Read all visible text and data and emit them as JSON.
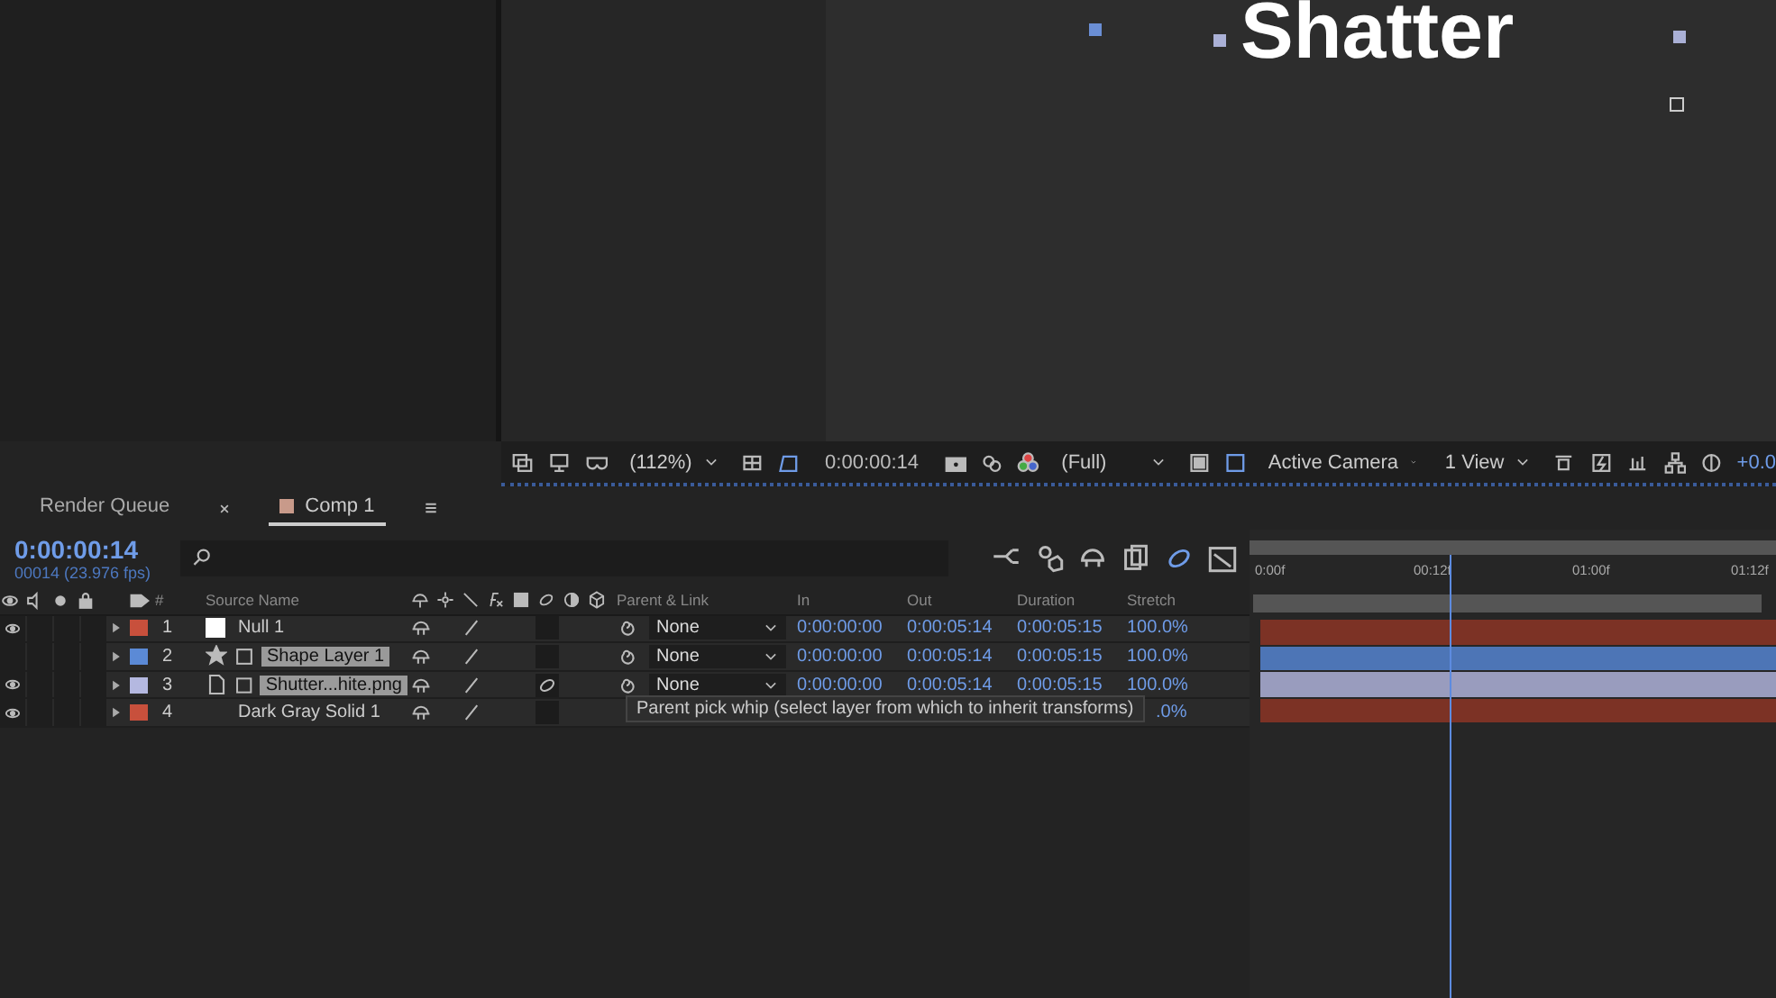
{
  "viewer": {
    "comp_text": "Shatter",
    "zoom": "(112%)",
    "timecode": "0:00:00:14",
    "resolution": "(Full)",
    "camera": "Active Camera",
    "views": "1 View",
    "exposure": "+0.0"
  },
  "tabs": [
    {
      "label": "Render Queue",
      "selected": false
    },
    {
      "label": "Comp 1",
      "selected": true,
      "color": "#c89a8a"
    }
  ],
  "timeline": {
    "current_time": "0:00:00:14",
    "frame_info": "00014 (23.976 fps)",
    "columns": [
      "#",
      "Source Name",
      "Parent & Link",
      "In",
      "Out",
      "Duration",
      "Stretch"
    ],
    "layers": [
      {
        "number": "1",
        "name": "Null 1",
        "kind": "null",
        "color": "#c8503c",
        "visible": true,
        "selected": false,
        "parent": "None",
        "in": "0:00:00:00",
        "out": "0:00:05:14",
        "duration": "0:00:05:15",
        "stretch": "100.0%",
        "motion_blur": false
      },
      {
        "number": "2",
        "name": "Shape Layer 1",
        "kind": "shape",
        "color": "#5b8ad6",
        "visible": false,
        "selected": true,
        "parent": "None",
        "in": "0:00:00:00",
        "out": "0:00:05:14",
        "duration": "0:00:05:15",
        "stretch": "100.0%",
        "motion_blur": false
      },
      {
        "number": "3",
        "name": "Shutter...hite.png",
        "kind": "footage",
        "color": "#b4b8e0",
        "visible": true,
        "selected": true,
        "parent": "None",
        "in": "0:00:00:00",
        "out": "0:00:05:14",
        "duration": "0:00:05:15",
        "stretch": "100.0%",
        "motion_blur": true
      },
      {
        "number": "4",
        "name": "Dark Gray Solid 1",
        "kind": "solid",
        "color": "#c8503c",
        "visible": true,
        "selected": false,
        "stretch": ".0%",
        "motion_blur": false
      }
    ],
    "tooltip": "Parent pick whip (select layer from which to inherit transforms)",
    "ruler": [
      "0:00f",
      "00:12f",
      "01:00f",
      "01:12f"
    ]
  }
}
